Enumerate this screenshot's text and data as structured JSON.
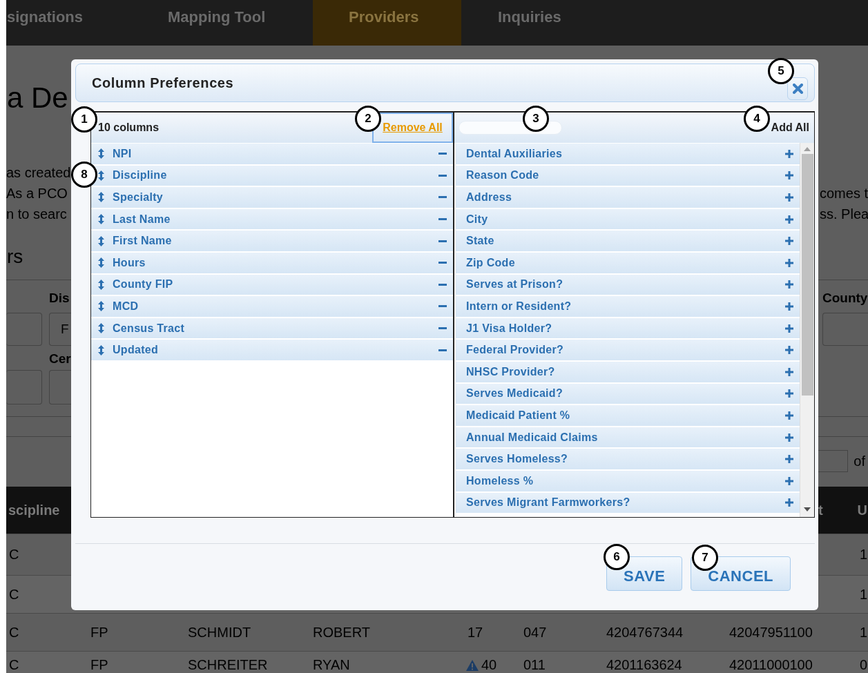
{
  "background_page": {
    "nav_tabs": [
      {
        "label": "signations",
        "selected": false
      },
      {
        "label": "Mapping Tool",
        "selected": false
      },
      {
        "label": "Providers",
        "selected": true
      },
      {
        "label": "Inquiries",
        "selected": false
      }
    ],
    "heading": "a De",
    "intro_left": [
      "as created",
      "As a PCO",
      "n to searc"
    ],
    "intro_right": [
      "comes t",
      "ss. Plea"
    ],
    "section_heading": "rs",
    "filters": {
      "label_1": "Dis",
      "label_2": "County",
      "label_3": "Cer",
      "field_value": "F"
    },
    "pager_of": "of",
    "table": {
      "columns": [
        "scipline",
        "t",
        "U"
      ],
      "rows": [
        {
          "first": "C",
          "last": "1"
        },
        {
          "first": "C",
          "last": "1"
        },
        {
          "first": "C",
          "cells": [
            "FP",
            "SCHMIDT",
            "ROBERT",
            "17",
            "047",
            "4204767344",
            "42047951100"
          ],
          "last": "1",
          "warning": false
        },
        {
          "first": "C",
          "cells": [
            "FP",
            "SCHREITER",
            "RYAN",
            "40",
            "011",
            "4201163624",
            "42011000100"
          ],
          "last": "0",
          "warning": true
        }
      ]
    }
  },
  "dialog": {
    "title": "Column Preferences",
    "selected_panel": {
      "count_label": "10 columns",
      "remove_all": "Remove All",
      "items": [
        {
          "label": "NPI"
        },
        {
          "label": "Discipline"
        },
        {
          "label": "Specialty"
        },
        {
          "label": "Last Name"
        },
        {
          "label": "First Name"
        },
        {
          "label": "Hours"
        },
        {
          "label": "County FIP"
        },
        {
          "label": "MCD"
        },
        {
          "label": "Census Tract"
        },
        {
          "label": "Updated"
        }
      ]
    },
    "available_panel": {
      "add_all": "Add All",
      "items": [
        {
          "label": "Dental Auxiliaries"
        },
        {
          "label": "Reason Code"
        },
        {
          "label": "Address"
        },
        {
          "label": "City"
        },
        {
          "label": "State"
        },
        {
          "label": "Zip Code"
        },
        {
          "label": "Serves at Prison?"
        },
        {
          "label": "Intern or Resident?"
        },
        {
          "label": "J1 Visa Holder?"
        },
        {
          "label": "Federal Provider?"
        },
        {
          "label": "NHSC Provider?"
        },
        {
          "label": "Serves Medicaid?"
        },
        {
          "label": "Medicaid Patient %"
        },
        {
          "label": "Annual Medicaid Claims"
        },
        {
          "label": "Serves Homeless?"
        },
        {
          "label": "Homeless %"
        },
        {
          "label": "Serves Migrant Farmworkers?"
        }
      ]
    },
    "buttons": [
      "SAVE",
      "CANCEL"
    ]
  },
  "callouts": [
    "1",
    "2",
    "3",
    "4",
    "5",
    "6",
    "7",
    "8"
  ]
}
